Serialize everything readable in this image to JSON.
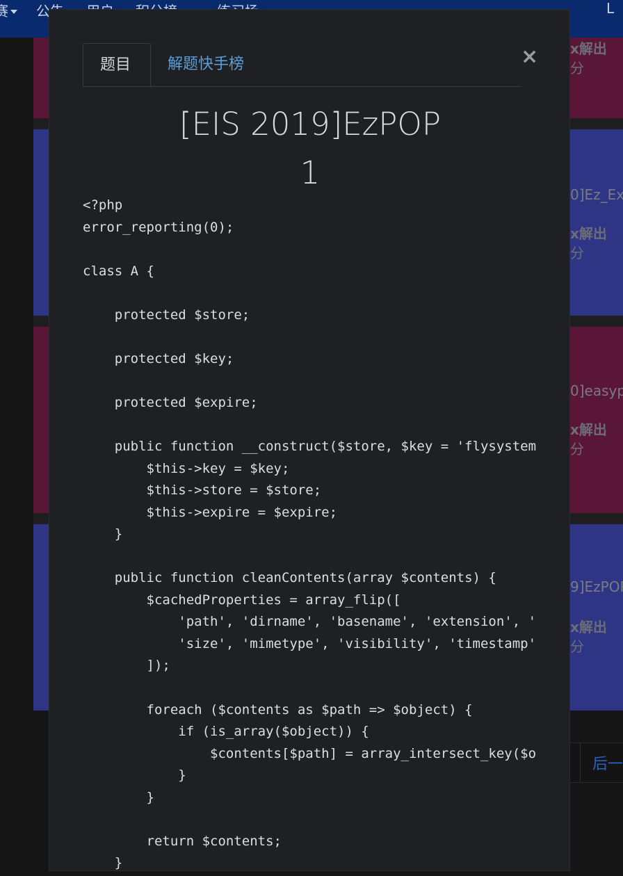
{
  "navbar": {
    "items": [
      {
        "label": "赛",
        "dropdown": true
      },
      {
        "label": "公告",
        "dropdown": false
      },
      {
        "label": "用户",
        "dropdown": false
      },
      {
        "label": "积分榜",
        "dropdown": true
      },
      {
        "label": "练习场",
        "dropdown": true
      },
      {
        "label": "L",
        "dropdown": false
      }
    ]
  },
  "background": {
    "cards": [
      {
        "title": "",
        "solved": "x解出",
        "score": "分"
      },
      {
        "title": "0]Ez_Ex",
        "solved": "x解出",
        "score": "分"
      },
      {
        "title": "0]easyp",
        "solved": "x解出",
        "score": "分"
      },
      {
        "title": "9]EzPOP",
        "solved": "x解出",
        "score": "分"
      }
    ],
    "pager_next": "后一"
  },
  "modal": {
    "tabs": [
      {
        "label": "题目",
        "active": true
      },
      {
        "label": "解题快手榜",
        "active": false
      }
    ],
    "close_label": "×",
    "title": "[EIS 2019]EzPOP",
    "points": "1",
    "code_lines": [
      "<?php",
      "error_reporting(0);",
      "",
      "class A {",
      "",
      "    protected $store;",
      "",
      "    protected $key;",
      "",
      "    protected $expire;",
      "",
      "    public function __construct($store, $key = 'flysystem', $expire = null) {",
      "        $this->key = $key;",
      "        $this->store = $store;",
      "        $this->expire = $expire;",
      "    }",
      "",
      "    public function cleanContents(array $contents) {",
      "        $cachedProperties = array_flip([",
      "            'path', 'dirname', 'basename', 'extension', 'filename',",
      "            'size', 'mimetype', 'visibility', 'timestamp', 'type',",
      "        ]);",
      "",
      "        foreach ($contents as $path => $object) {",
      "            if (is_array($object)) {",
      "                $contents[$path] = array_intersect_key($object, $cachedProperties);",
      "            }",
      "        }",
      "",
      "        return $contents;",
      "    }"
    ]
  }
}
